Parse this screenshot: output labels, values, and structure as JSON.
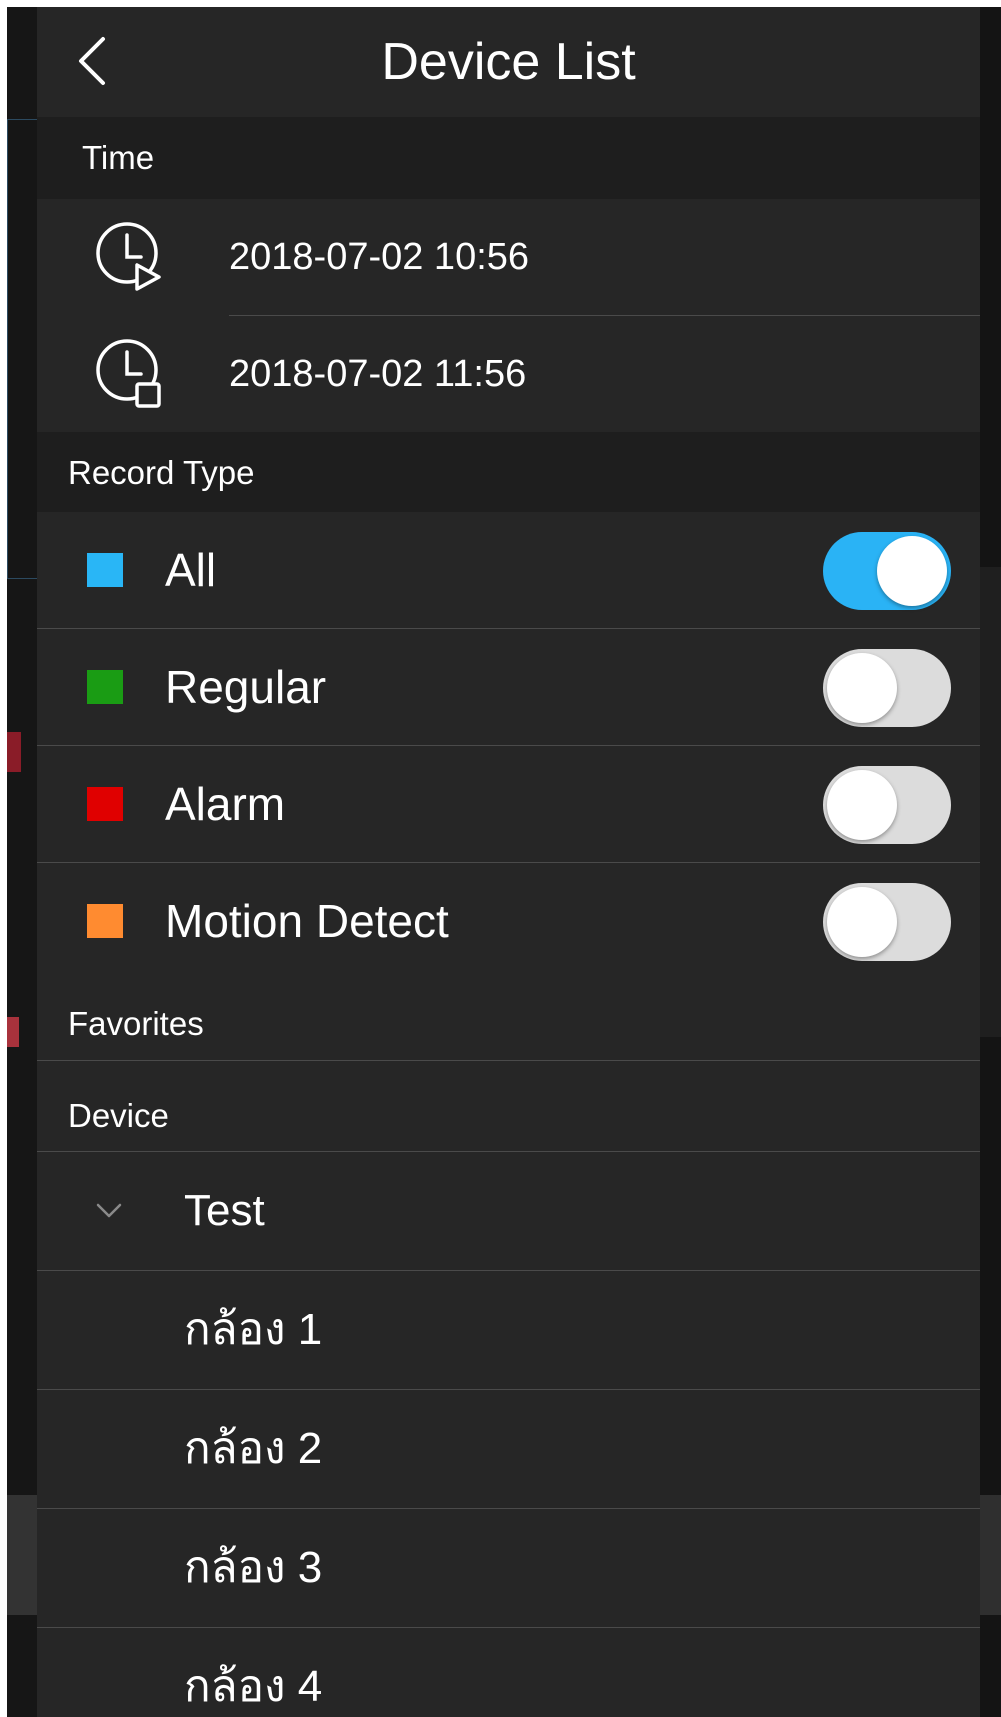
{
  "header": {
    "title": "Device List"
  },
  "sections": {
    "time_label": "Time",
    "record_type_label": "Record Type",
    "favorites_label": "Favorites",
    "device_label": "Device"
  },
  "time": {
    "start": "2018-07-02 10:56",
    "end": "2018-07-02 11:56"
  },
  "record_types": [
    {
      "label": "All",
      "color": "#29b6f6",
      "enabled": true
    },
    {
      "label": "Regular",
      "color": "#1a9c14",
      "enabled": false
    },
    {
      "label": "Alarm",
      "color": "#e00000",
      "enabled": false
    },
    {
      "label": "Motion Detect",
      "color": "#ff8b30",
      "enabled": false
    }
  ],
  "devices": {
    "group": "Test",
    "cameras": [
      "กล้อง 1",
      "กล้อง 2",
      "กล้อง 3",
      "กล้อง 4"
    ]
  },
  "colors": {
    "panel_bg": "#262626",
    "section_bg": "#1e1e1e",
    "toggle_on": "#2ab3f5",
    "toggle_off": "#dcdcdc"
  }
}
